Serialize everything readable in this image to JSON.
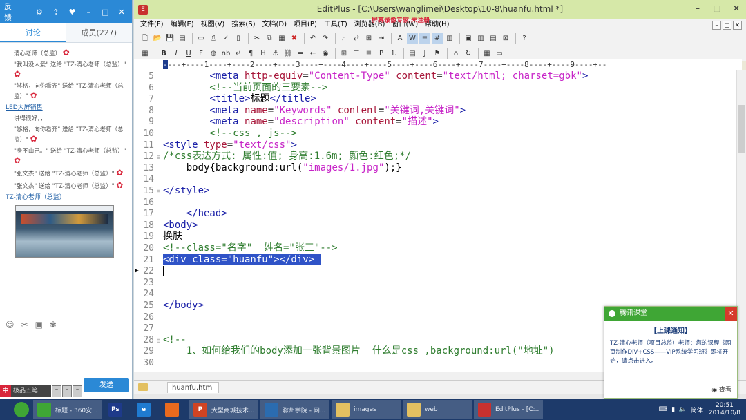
{
  "chat": {
    "feedback": "反馈",
    "tabs": [
      "讨论",
      "成员(227)"
    ],
    "messages": [
      {
        "type": "text",
        "text": "清心老师（总监）"
      },
      {
        "type": "text",
        "text": "\"我叫没人爱\" 送给 \"TZ-清心老师（总监）\""
      },
      {
        "type": "text",
        "text": "\"够格，向你看齐\" 送给 \"TZ-清心老师（总监）\""
      },
      {
        "type": "sender",
        "text": "LED大屏销售"
      },
      {
        "type": "text",
        "text": "讲得很好，，"
      },
      {
        "type": "text",
        "text": "\"够格，向你看齐\" 送给 \"TZ-清心老师（总监）\""
      },
      {
        "type": "text",
        "text": "\"身不由己。\" 送给 \"TZ-清心老师（总监）\""
      },
      {
        "type": "text",
        "text": "\"张文杰\" 送给 \"TZ-清心老师（总监）\""
      },
      {
        "type": "text",
        "text": "\"张文杰\" 送给 \"TZ-清心老师（总监）\""
      },
      {
        "type": "sender",
        "text": "TZ-清心老师（总监）"
      }
    ],
    "send_label": "发送",
    "ime_name": "极品五笔"
  },
  "editor": {
    "title": "EditPlus - [C:\\Users\\wanglimei\\Desktop\\10-8\\huanfu.html *]",
    "watermark": "屏幕录像专家 未注册",
    "menus": [
      "文件(F)",
      "编辑(E)",
      "视图(V)",
      "搜索(S)",
      "文档(D)",
      "项目(P)",
      "工具(T)",
      "浏览器(B)",
      "窗口(W)",
      "帮助(H)"
    ],
    "ruler": "---+----1----+----2----+----3----+----4----+----5----+----6----+----7----+----8----+----9----+--",
    "file_tab": "huanfu.html",
    "lines": [
      {
        "n": "5",
        "t": "        <meta http-equiv=\"Content-Type\" content=\"text/html; charset=gbk\">"
      },
      {
        "n": "6",
        "t": "        <!--当前页面的三要素-->"
      },
      {
        "n": "7",
        "t": "        <title>标题</title>"
      },
      {
        "n": "8",
        "t": "        <meta name=\"Keywords\" content=\"关键词,关键词\">"
      },
      {
        "n": "9",
        "t": "        <meta name=\"description\" content=\"描述\">"
      },
      {
        "n": "10",
        "t": "        <!--css , js-->"
      },
      {
        "n": "11",
        "t": "<style type=\"text/css\">"
      },
      {
        "n": "12",
        "t": "/*css表达方式: 属性:值; 身高:1.6m; 颜色:红色;*/"
      },
      {
        "n": "13",
        "t": "    body{background:url(\"images/1.jpg\");}"
      },
      {
        "n": "14",
        "t": ""
      },
      {
        "n": "15",
        "t": "</style>"
      },
      {
        "n": "16",
        "t": ""
      },
      {
        "n": "17",
        "t": "    </head>"
      },
      {
        "n": "18",
        "t": "<body>"
      },
      {
        "n": "19",
        "t": "换肤"
      },
      {
        "n": "20",
        "t": "<!--class=\"名字\"  姓名=\"张三\"-->"
      },
      {
        "n": "21",
        "t": "<div class=\"huanfu\"></div> "
      },
      {
        "n": "22",
        "t": ""
      },
      {
        "n": "23",
        "t": ""
      },
      {
        "n": "24",
        "t": ""
      },
      {
        "n": "25",
        "t": "</body>"
      },
      {
        "n": "26",
        "t": ""
      },
      {
        "n": "27",
        "t": ""
      },
      {
        "n": "28",
        "t": "<!--"
      },
      {
        "n": "29",
        "t": "    1、如何给我们的body添加一张背景图片  什么是css ,background:url(\"地址\")"
      },
      {
        "n": "30",
        "t": ""
      }
    ]
  },
  "notification": {
    "app": "腾讯课堂",
    "heading": "【上课通知】",
    "body": "TZ-清心老师（项目总监）老师：您的课程《网页制作DIV+CSS——VIP系统学习班》即将开始，请点击进入。",
    "view_label": "查看"
  },
  "taskbar": {
    "tasks": [
      {
        "label": "标题 - 360安...",
        "color": "#3fa635",
        "icon": "360-browser-icon"
      },
      {
        "label": "",
        "color": "#1e3a8a",
        "icon": "photoshop-icon",
        "glyph": "Ps"
      },
      {
        "label": "",
        "color": "#1f7bd1",
        "icon": "ie-icon",
        "glyph": "e"
      },
      {
        "label": "",
        "color": "#e86a1e",
        "icon": "firefox-icon",
        "glyph": ""
      },
      {
        "label": "大型商城技术...",
        "color": "#d04423",
        "icon": "powerpoint-icon",
        "glyph": "P"
      },
      {
        "label": "滁州学院 - 网...",
        "color": "#2b6cb0",
        "icon": "course-icon",
        "glyph": ""
      },
      {
        "label": "images",
        "color": "#e3c061",
        "icon": "folder-icon",
        "glyph": ""
      },
      {
        "label": "web",
        "color": "#e3c061",
        "icon": "folder-icon",
        "glyph": ""
      },
      {
        "label": "EditPlus - [C:...",
        "color": "#c8312f",
        "icon": "editplus-icon",
        "glyph": ""
      }
    ],
    "ime": "简体",
    "time": "20:51",
    "date": "2014/10/8"
  }
}
